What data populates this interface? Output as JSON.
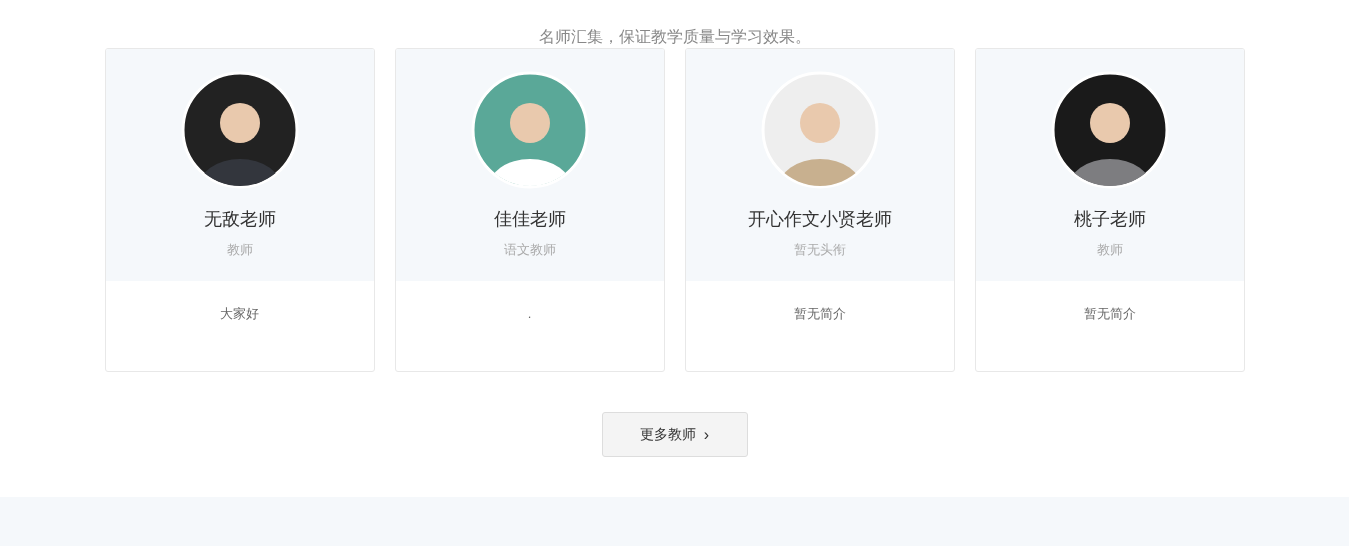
{
  "subtitle": "名师汇集，保证教学质量与学习效果。",
  "teachers": [
    {
      "name": "无敌老师",
      "title": "教师",
      "bio": "大家好"
    },
    {
      "name": "佳佳老师",
      "title": "语文教师",
      "bio": "."
    },
    {
      "name": "开心作文小贤老师",
      "title": "暂无头衔",
      "bio": "暂无简介"
    },
    {
      "name": "桃子老师",
      "title": "教师",
      "bio": "暂无简介"
    }
  ],
  "more_button": {
    "label": "更多教师",
    "icon": "›"
  }
}
